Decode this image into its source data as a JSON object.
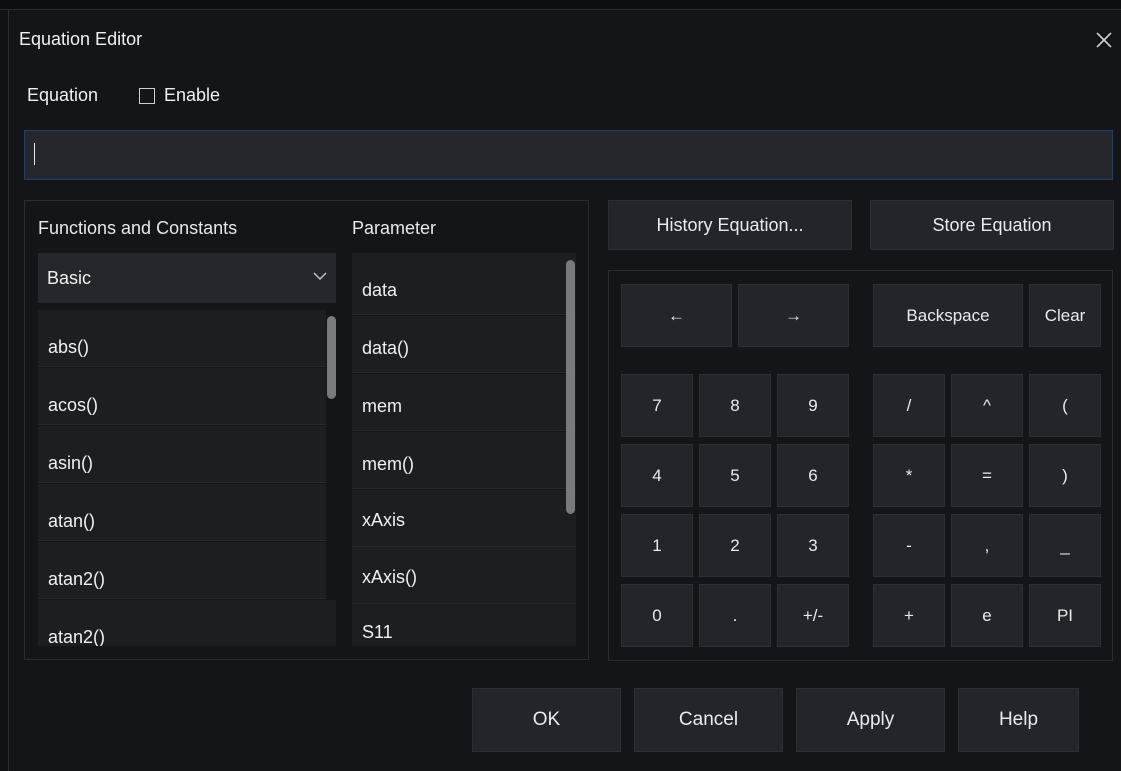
{
  "dialog": {
    "title": "Equation Editor",
    "equation_label": "Equation",
    "enable_label": "Enable",
    "enable_checked": false,
    "equation_value": ""
  },
  "functions": {
    "header": "Functions and Constants",
    "category": "Basic",
    "items": [
      "abs()",
      "acos()",
      "asin()",
      "atan()",
      "atan2()",
      "atan2()"
    ]
  },
  "parameter": {
    "header": "Parameter",
    "items": [
      "data",
      "data()",
      "mem",
      "mem()",
      "xAxis",
      "xAxis()",
      "S11"
    ]
  },
  "actions": {
    "history": "History Equation...",
    "store": "Store Equation"
  },
  "keypad": {
    "left": "←",
    "right": "→",
    "backspace": "Backspace",
    "clear": "Clear",
    "digits": [
      [
        "7",
        "8",
        "9"
      ],
      [
        "4",
        "5",
        "6"
      ],
      [
        "1",
        "2",
        "3"
      ],
      [
        "0",
        ".",
        "+/-"
      ]
    ],
    "ops": [
      [
        "/",
        "^",
        "("
      ],
      [
        "*",
        "=",
        ")"
      ],
      [
        "-",
        ",",
        "_"
      ],
      [
        "+",
        "e",
        "PI"
      ]
    ]
  },
  "footer": {
    "ok": "OK",
    "cancel": "Cancel",
    "apply": "Apply",
    "help": "Help"
  },
  "icons": {
    "close": "close-icon",
    "dropdown": "chevron-down-icon"
  },
  "colors": {
    "background": "#141519",
    "button": "#23252a",
    "input_border": "#20406a"
  }
}
